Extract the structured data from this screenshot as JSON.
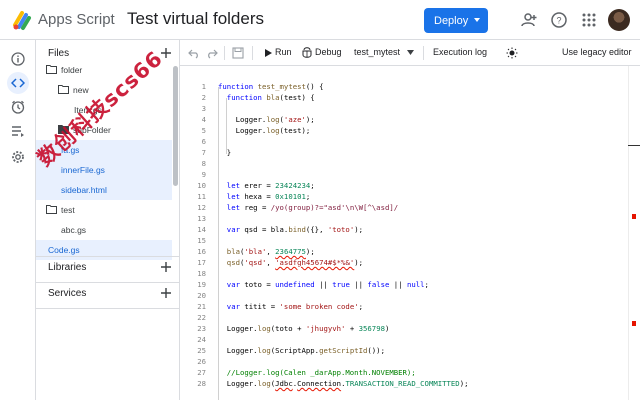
{
  "header": {
    "app_name": "Apps Script",
    "project_title": "Test virtual folders",
    "deploy_label": "Deploy",
    "icons": [
      "add-person-icon",
      "help-icon",
      "apps-grid-icon"
    ]
  },
  "rail": {
    "items": [
      "info-icon",
      "code-icon",
      "clock-icon",
      "executions-icon",
      "settings-icon"
    ],
    "active": "code-icon"
  },
  "files_panel": {
    "title": "Files",
    "tree": [
      {
        "label": "folder",
        "type": "folder",
        "level": 0
      },
      {
        "label": "new",
        "type": "folder",
        "level": 1
      },
      {
        "label": "Item.gs",
        "type": "file",
        "level": 2
      },
      {
        "label": "subFolder",
        "type": "folder",
        "level": 1
      },
      {
        "label": "fa.gs",
        "type": "file",
        "level": 1,
        "selected": true
      },
      {
        "label": "innerFile.gs",
        "type": "file",
        "level": 1,
        "selected": true
      },
      {
        "label": "sidebar.html",
        "type": "file",
        "level": 0,
        "selected": true
      },
      {
        "label": "test",
        "type": "folder",
        "level": 0
      },
      {
        "label": "abc.gs",
        "type": "file",
        "level": 1
      },
      {
        "label": "Code.gs",
        "type": "file",
        "level": 0,
        "selected": true
      }
    ],
    "libraries_label": "Libraries",
    "services_label": "Services"
  },
  "watermark": "数创科技scs66",
  "toolbar": {
    "run_label": "Run",
    "debug_label": "Debug",
    "function_select": "test_mytest",
    "execution_log_label": "Execution log",
    "legacy_label": "Use legacy editor"
  },
  "editor": {
    "lines": [
      {
        "n": "1",
        "text": "function test_mytest() {"
      },
      {
        "n": "2",
        "text": "  function bla(test) {"
      },
      {
        "n": "3",
        "text": ""
      },
      {
        "n": "4",
        "text": "    Logger.log('aze');"
      },
      {
        "n": "5",
        "text": "    Logger.log(test);"
      },
      {
        "n": "6",
        "text": ""
      },
      {
        "n": "7",
        "text": "  }"
      },
      {
        "n": "8",
        "text": ""
      },
      {
        "n": "9",
        "text": ""
      },
      {
        "n": "10",
        "text": "  let erer = 23424234;"
      },
      {
        "n": "11",
        "text": "  let hexa = 0x10101;"
      },
      {
        "n": "12",
        "text": "  let reg = /yo(group)?=\"asd'\\n\\W[^\\asd]/"
      },
      {
        "n": "13",
        "text": ""
      },
      {
        "n": "14",
        "text": "  var qsd = bla.bind({}, 'toto');"
      },
      {
        "n": "15",
        "text": ""
      },
      {
        "n": "16",
        "text": "  bla('bla', 2364775);"
      },
      {
        "n": "17",
        "text": "  qsd('qsd', 'asdfgh45674#$*%&');"
      },
      {
        "n": "18",
        "text": ""
      },
      {
        "n": "19",
        "text": "  var toto = undefined || true || false || null;"
      },
      {
        "n": "20",
        "text": ""
      },
      {
        "n": "21",
        "text": "  var titit = 'some broken code';"
      },
      {
        "n": "22",
        "text": ""
      },
      {
        "n": "23",
        "text": "  Logger.log(toto + 'jhugyvh' + 356798)"
      },
      {
        "n": "24",
        "text": ""
      },
      {
        "n": "25",
        "text": "  Logger.log(ScriptApp.getScriptId());"
      },
      {
        "n": "26",
        "text": ""
      },
      {
        "n": "27",
        "text": "  //Logger.log(Calen _darApp.Month.NOVEMBER);"
      },
      {
        "n": "28",
        "text": "  Logger.log(Jdbc.Connection.TRANSACTION_READ_COMMITTED);"
      }
    ]
  },
  "colors": {
    "accent": "#1a73e8",
    "selection": "#e8f0fe",
    "watermark": "#c8102e"
  }
}
